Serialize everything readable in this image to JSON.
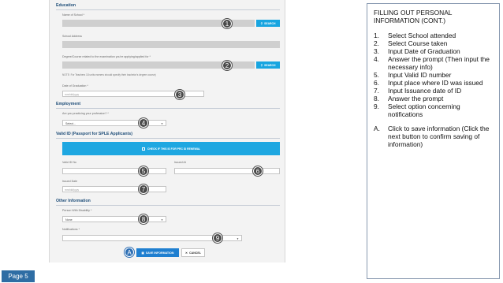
{
  "form": {
    "education_title": "Education",
    "school_label": "Name of School *",
    "search_label": "SEARCH",
    "school_address_label": "School Address",
    "degree_label": "Degree/Course related to the examination you're applying/applied for *",
    "degree_note": "NOTE: For Teachers 18 units earners should specify their bachelor's degree course)",
    "grad_date_label": "Date of Graduation *",
    "grad_date_placeholder": "mm/dd/yyyy",
    "employment_title": "Employment",
    "profession_label": "Are you practicing your profession? *",
    "profession_value": "Select...",
    "valid_id_title": "Valid ID (Passport for SPLE Applicants)",
    "renewal_label": "CHECK IF THIS IS FOR PRC ID RENEWAL",
    "valid_id_no_label": "Valid ID No",
    "issued_at_label": "Issued At",
    "issued_date_label": "Issued Date",
    "issued_date_placeholder": "mm/dd/yyyy",
    "other_info_title": "Other Information",
    "disability_label": "Person With Disability *",
    "disability_value": "None",
    "notifications_label": "Notifications *",
    "save_label": "SAVE INFORMATION",
    "cancel_label": "CANCEL"
  },
  "markers": [
    "1",
    "2",
    "3",
    "4",
    "5",
    "6",
    "7",
    "8",
    "9",
    "A"
  ],
  "instructions": {
    "title": "FILLING OUT PERSONAL INFORMATION (CONT.)",
    "steps": [
      {
        "n": "1.",
        "text": "Select School attended"
      },
      {
        "n": "2.",
        "text": "Select Course taken"
      },
      {
        "n": "3.",
        "text": "Input Date of Graduation"
      },
      {
        "n": "4.",
        "text": "Answer the prompt (Then input the necessary info)"
      },
      {
        "n": "5.",
        "text": "Input Valid ID number"
      },
      {
        "n": "6.",
        "text": "Input place where ID was issued"
      },
      {
        "n": "7.",
        "text": "Input Issuance date of ID"
      },
      {
        "n": "8.",
        "text": "Answer the prompt"
      },
      {
        "n": "9.",
        "text": "Select option concerning notifications"
      }
    ],
    "a_step": {
      "n": "A.",
      "text": "Click to save information (Click the next button to confirm saving of information)"
    }
  },
  "page_label": "Page 5",
  "colors": {
    "accent": "#18a5e0",
    "save": "#1f7fd0",
    "section": "#1f4e79",
    "page_label": "#2e6da4"
  }
}
